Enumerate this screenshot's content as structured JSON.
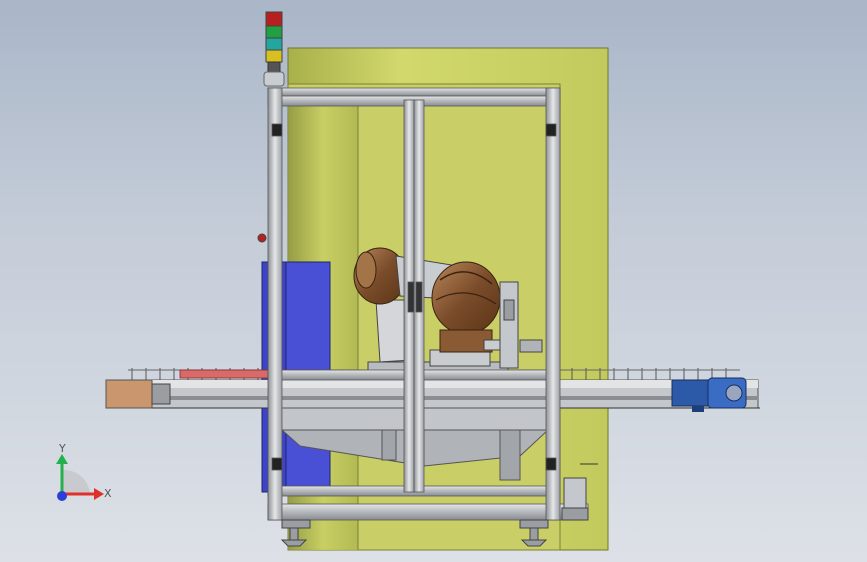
{
  "triad": {
    "x_label": "X",
    "y_label": "Y",
    "colors": {
      "x": "#e0302a",
      "y": "#22b14c",
      "z": "#2a3fd8"
    }
  },
  "colors": {
    "background": "#b4bfce",
    "enclosure_panel": "#c8cf62",
    "frame": "#c6c9cd",
    "robot_body": "#8a5a34",
    "blue_panel": "#3e44c9",
    "conveyor_end_cap": "#c9966e",
    "motor": "#2c5aa8",
    "signal_red": "#b82020",
    "signal_green": "#20a040",
    "signal_yellow": "#d8c020"
  },
  "icons": [
    "signal-tower-icon",
    "coordinate-triad-icon",
    "conveyor-motor-icon"
  ]
}
